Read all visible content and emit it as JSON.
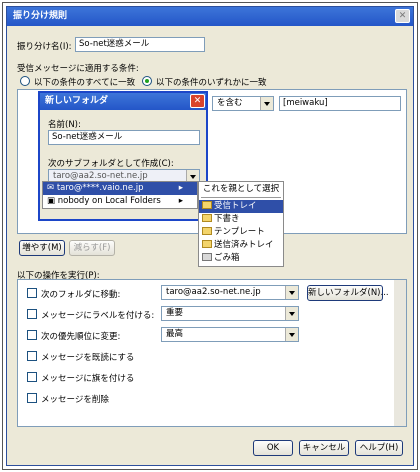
{
  "dialog": {
    "title": "振り分け規則",
    "close": "✕"
  },
  "filter_name": {
    "label": "振り分け名(I):",
    "value": "So-net迷惑メール"
  },
  "conditions": {
    "label": "受信メッセージに適用する条件:",
    "option_all": "以下の条件のすべてに一致",
    "option_any": "以下の条件のいずれかに一致",
    "operator": "を含む",
    "value": "[meiwaku]",
    "add_btn": "増やす(M)",
    "remove_btn": "減らす(F)"
  },
  "actions": {
    "label": "以下の操作を実行(P):",
    "rows": [
      {
        "label": "次のフォルダに移動:",
        "value": "taro@aa2.so-net.ne.jp",
        "button": "新しいフォルダ(N)..."
      },
      {
        "label": "メッセージにラベルを付ける:",
        "value": "重要"
      },
      {
        "label": "次の優先順位に変更:",
        "value": "最高"
      },
      {
        "label": "メッセージを既読にする"
      },
      {
        "label": "メッセージに旗を付ける"
      },
      {
        "label": "メッセージを削除"
      }
    ]
  },
  "footer": {
    "ok": "OK",
    "cancel": "キャンセル",
    "help": "ヘルプ(H)"
  },
  "new_folder": {
    "title": "新しいフォルダ",
    "name_label": "名前(N):",
    "name_value": "So-net迷惑メール",
    "parent_label": "次のサブフォルダとして作成(C):",
    "parent_value": "taro@aa2.so-net.ne.jp",
    "close": "✕"
  },
  "menu": {
    "accounts": [
      "taro@****.vaio.ne.jp",
      "nobody on Local Folders"
    ],
    "select_parent": "これを親として選択",
    "folders": [
      "受信トレイ",
      "下書き",
      "テンプレート",
      "送信済みトレイ",
      "ごみ箱"
    ]
  }
}
